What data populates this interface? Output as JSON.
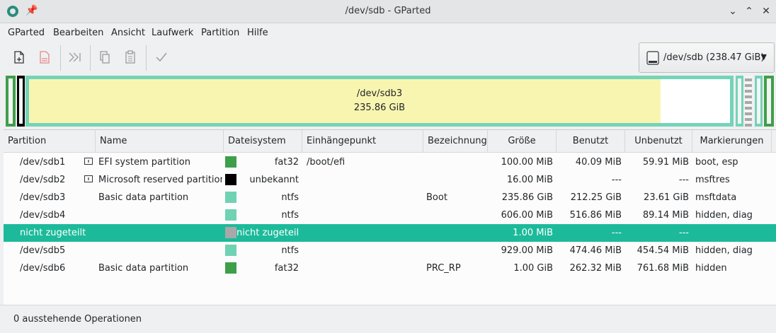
{
  "window": {
    "title": "/dev/sdb - GParted"
  },
  "menu": [
    "GParted",
    "Bearbeiten",
    "Ansicht",
    "Laufwerk",
    "Partition",
    "Hilfe"
  ],
  "toolbar": {
    "tools": [
      "new-partition-icon",
      "delete-partition-icon",
      "resize-move-icon",
      "copy-icon",
      "paste-icon",
      "apply-icon"
    ]
  },
  "device_selector": {
    "label": "/dev/sdb (238.47 GiB)"
  },
  "disk_graphic": {
    "main_partition": {
      "name": "/dev/sdb3",
      "size": "235.86 GiB",
      "used_fraction": 0.9
    }
  },
  "table": {
    "columns": [
      "Partition",
      "Name",
      "Dateisystem",
      "Einhängepunkt",
      "Bezeichnung",
      "Größe",
      "Benutzt",
      "Unbenutzt",
      "Markierungen"
    ],
    "rows": [
      {
        "partition": "/dev/sdb1",
        "name": "EFI system partition",
        "fs": "fat32",
        "fs_color": "#3e9f4a",
        "mount": "/boot/efi",
        "label": "",
        "size": "100.00 MiB",
        "used": "40.09 MiB",
        "unused": "59.91 MiB",
        "flags": "boot, esp",
        "icon": "info-icon"
      },
      {
        "partition": "/dev/sdb2",
        "name": "Microsoft reserved partition",
        "fs": "unbekannt",
        "fs_color": "#000000",
        "mount": "",
        "label": "",
        "size": "16.00 MiB",
        "used": "---",
        "unused": "---",
        "flags": "msftres",
        "icon": "warning-icon"
      },
      {
        "partition": "/dev/sdb3",
        "name": "Basic data partition",
        "fs": "ntfs",
        "fs_color": "#6fd2b3",
        "mount": "",
        "label": "Boot",
        "size": "235.86 GiB",
        "used": "212.25 GiB",
        "unused": "23.61 GiB",
        "flags": "msftdata"
      },
      {
        "partition": "/dev/sdb4",
        "name": "",
        "fs": "ntfs",
        "fs_color": "#6fd2b3",
        "mount": "",
        "label": "",
        "size": "606.00 MiB",
        "used": "516.86 MiB",
        "unused": "89.14 MiB",
        "flags": "hidden, diag"
      },
      {
        "partition": "nicht zugeteilt",
        "name": "",
        "fs": "nicht zugeteilt",
        "fs_color": "#a8a8a8",
        "mount": "",
        "label": "",
        "size": "1.00 MiB",
        "used": "---",
        "unused": "---",
        "flags": "",
        "selected": true
      },
      {
        "partition": "/dev/sdb5",
        "name": "",
        "fs": "ntfs",
        "fs_color": "#6fd2b3",
        "mount": "",
        "label": "",
        "size": "929.00 MiB",
        "used": "474.46 MiB",
        "unused": "454.54 MiB",
        "flags": "hidden, diag"
      },
      {
        "partition": "/dev/sdb6",
        "name": "Basic data partition",
        "fs": "fat32",
        "fs_color": "#3e9f4a",
        "mount": "",
        "label": "PRC_RP",
        "size": "1.00 GiB",
        "used": "262.32 MiB",
        "unused": "761.68 MiB",
        "flags": "hidden"
      }
    ]
  },
  "status": {
    "text": "0 ausstehende Operationen"
  }
}
